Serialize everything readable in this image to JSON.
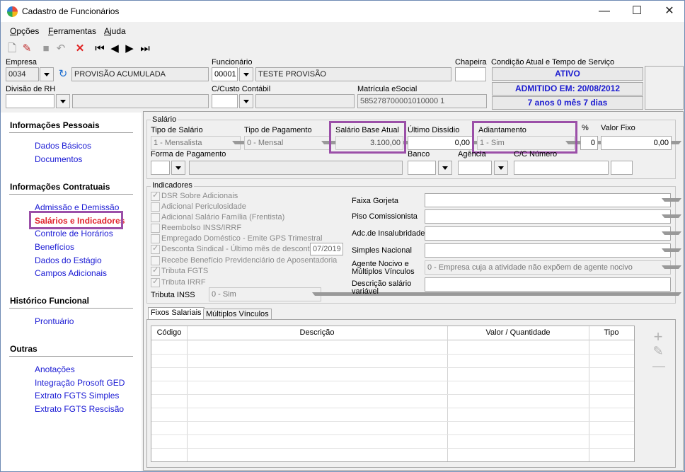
{
  "window": {
    "title": "Cadastro de Funcionários",
    "minimize": "—",
    "maximize": "☐",
    "close": "✕"
  },
  "menu": {
    "opcoes_u": "O",
    "opcoes": "pções",
    "ferramentas_u": "F",
    "ferramentas": "erramentas",
    "ajuda_u": "A",
    "ajuda": "juda"
  },
  "header": {
    "empresa_label": "Empresa",
    "empresa_code": "0034",
    "empresa_name": "PROVISÃO ACUMULADA",
    "funcionario_label": "Funcionário",
    "funcionario_code": "00001",
    "funcionario_name": "TESTE PROVISÃO",
    "chapeira_label": "Chapeira",
    "condicao_label": "Condição Atual e Tempo de Serviço",
    "status": "ATIVO",
    "admitido": "ADMITIDO EM: 20/08/2012",
    "tempo": "7 anos 0 mês 7 dias",
    "divisao_label": "Divisão de RH",
    "ccusto_label": "C/Custo Contábil",
    "matricula_label": "Matrícula eSocial",
    "matricula_value": "585278700001010000 1"
  },
  "sidebar": {
    "pessoais_head": "Informações Pessoais",
    "dados_basicos": "Dados Básicos",
    "documentos": "Documentos",
    "contratuais_head": "Informações Contratuais",
    "admissao": "Admissão e Demissão",
    "salarios": "Salários e Indicadores",
    "controle": "Controle de Horários",
    "beneficios": "Benefícios",
    "estagio": "Dados do Estágio",
    "campos": "Campos Adicionais",
    "historico_head": "Histórico Funcional",
    "prontuario": "Prontuário",
    "outras_head": "Outras",
    "anotacoes": "Anotações",
    "integracao": "Integração Prosoft GED",
    "extrato_simples": "Extrato FGTS Simples",
    "extrato_rescisao": "Extrato FGTS Rescisão"
  },
  "salario": {
    "group": "Salário",
    "tipo_label": "Tipo de Salário",
    "tipo_value": "1 - Mensalista",
    "pagamento_label": "Tipo de Pagamento",
    "pagamento_value": "0 - Mensal",
    "base_label": "Salário Base Atual",
    "base_value": "3.100,00",
    "dissidio_label": "Último Dissídio",
    "dissidio_value": "0,00",
    "adiantamento_label": "Adiantamento",
    "adiantamento_value": "1 - Sim",
    "pct_label": "%",
    "pct_value": "0",
    "fixo_label": "Valor Fixo",
    "fixo_value": "0,00",
    "forma_label": "Forma de Pagamento",
    "banco_label": "Banco",
    "agencia_label": "Agência",
    "conta_label": "C/C Número"
  },
  "indicadores": {
    "group": "Indicadores",
    "items": [
      {
        "label": "DSR Sobre Adicionais",
        "checked": true
      },
      {
        "label": "Adicional Periculosidade",
        "checked": false
      },
      {
        "label": "Adicional Salário Família (Frentista)",
        "checked": false
      },
      {
        "label": "Reembolso INSS/IRRF",
        "checked": false
      },
      {
        "label": "Empregado Doméstico - Emite GPS Trimestral",
        "checked": false
      },
      {
        "label": "Desconta Sindical - Último mês de desconto",
        "checked": true
      },
      {
        "label": "Recebe Benefício Previdenciário de Aposentadoria",
        "checked": false
      },
      {
        "label": "Tributa FGTS",
        "checked": true
      },
      {
        "label": "Tributa IRRF",
        "checked": true
      }
    ],
    "sindical_month": "07/2019",
    "tributa_inss_label": "Tributa INSS",
    "tributa_inss_value": "0 - Sim",
    "faixa_label": "Faixa Gorjeta",
    "piso_label": "Piso Comissionista",
    "insalubridade_label": "Adc.de Insalubridade",
    "simples_label": "Simples Nacional",
    "agente_label_1": "Agente Nocivo e",
    "agente_label_2": "Múltiplos Vínculos",
    "agente_value": "0 - Empresa cuja a atividade não expõem de agente nocivo",
    "descricao_label_1": "Descrição salário",
    "descricao_label_2": "variável"
  },
  "tabs": {
    "fixos": "Fixos Salariais",
    "multiplos": "Múltiplos Vínculos"
  },
  "grid": {
    "col_codigo": "Código",
    "col_descricao": "Descrição",
    "col_valor": "Valor / Quantidade",
    "col_tipo": "Tipo"
  },
  "actions": {
    "add": "+",
    "edit": "✎",
    "remove": "—"
  }
}
